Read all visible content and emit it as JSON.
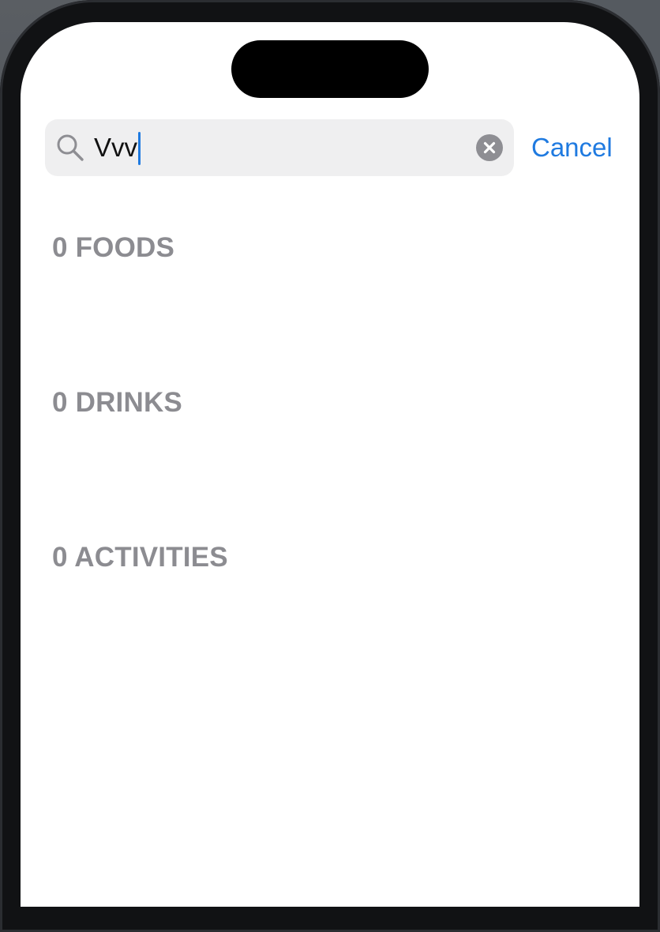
{
  "search": {
    "value": "Vvv",
    "cancel_label": "Cancel",
    "icon": "magnifying-glass",
    "clear_icon": "xmark-circle-fill"
  },
  "sections": [
    {
      "label": "0 FOODS"
    },
    {
      "label": "0 DRINKS"
    },
    {
      "label": "0 ACTIVITIES"
    }
  ],
  "colors": {
    "accent": "#1f7ae0",
    "section_header": "#8c8c91",
    "search_field_bg": "#efeff0",
    "screen_bg": "#ffffff"
  }
}
